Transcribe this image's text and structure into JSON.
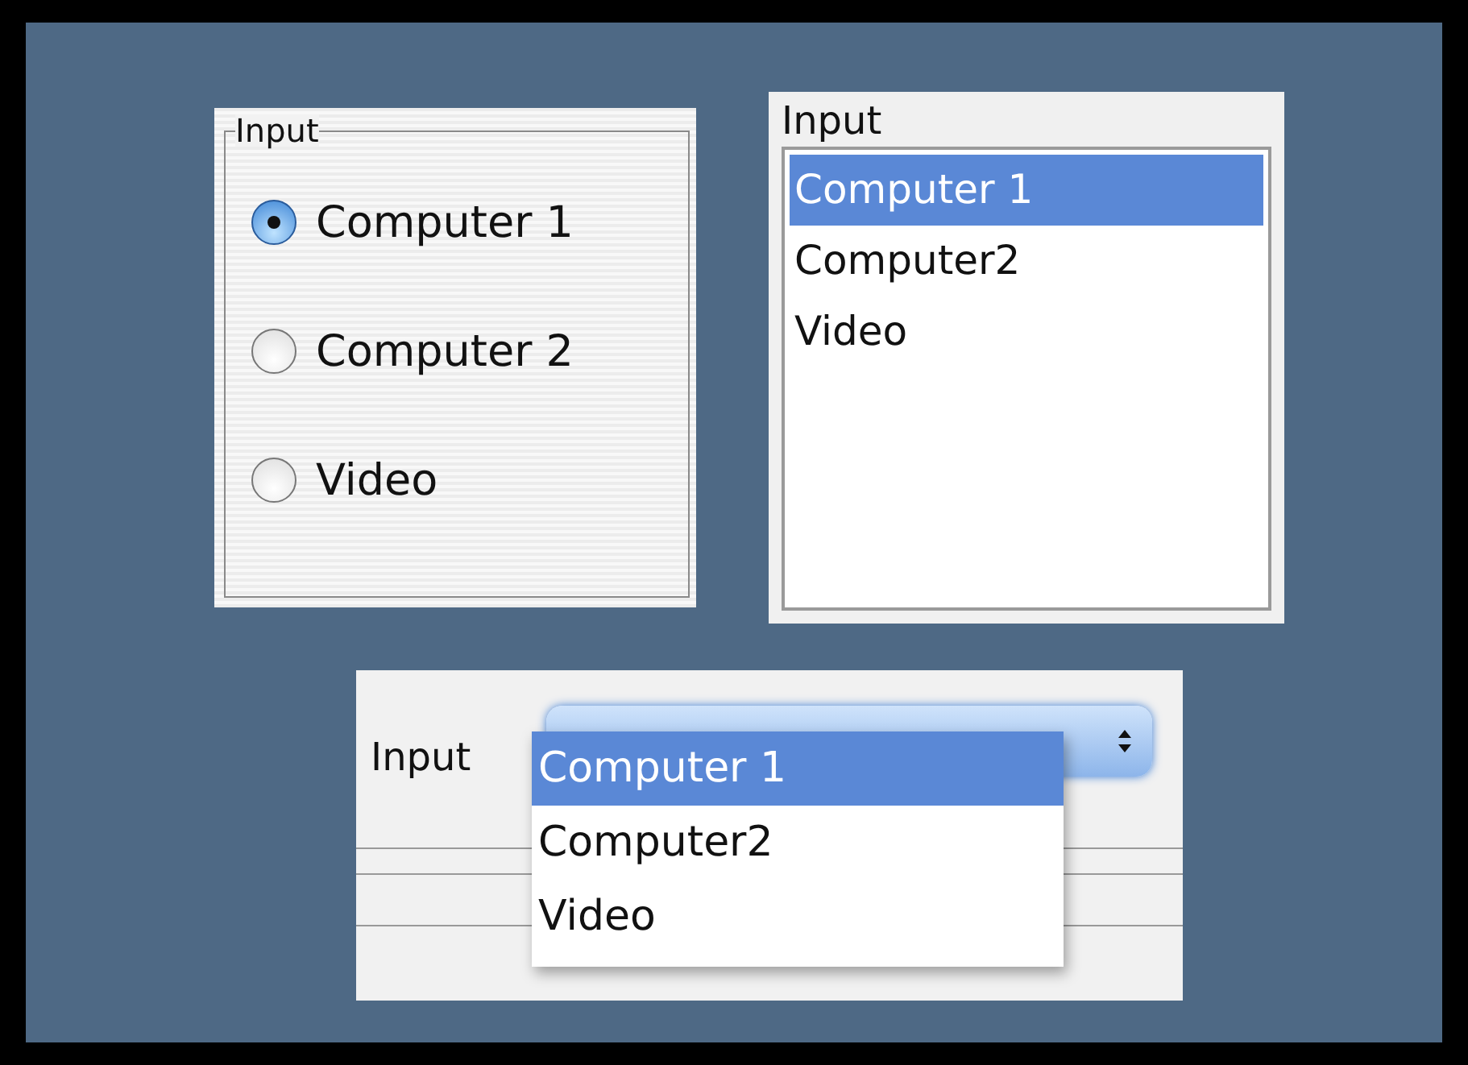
{
  "radio_group": {
    "title": "Input",
    "options": [
      {
        "label": "Computer 1",
        "selected": true
      },
      {
        "label": "Computer 2",
        "selected": false
      },
      {
        "label": "Video",
        "selected": false
      }
    ]
  },
  "list_box": {
    "label": "Input",
    "items": [
      {
        "label": "Computer 1",
        "selected": true
      },
      {
        "label": "Computer2",
        "selected": false
      },
      {
        "label": "Video",
        "selected": false
      }
    ]
  },
  "popup": {
    "label": "Input",
    "menu_items": [
      {
        "label": "Computer 1",
        "selected": true
      },
      {
        "label": "Computer2",
        "selected": false
      },
      {
        "label": "Video",
        "selected": false
      }
    ]
  }
}
